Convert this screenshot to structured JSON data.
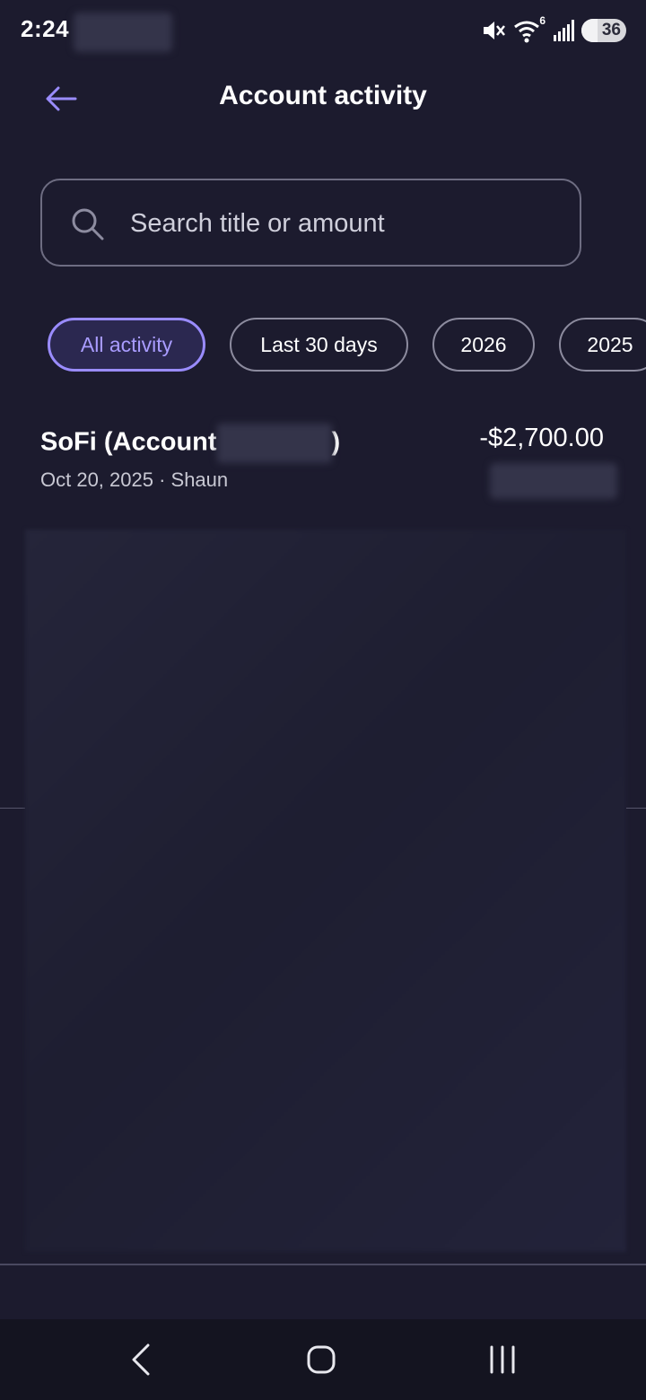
{
  "status_bar": {
    "time": "2:24",
    "battery": "36",
    "wifi_badge": "6",
    "icons": [
      "mute-icon",
      "wifi-icon",
      "signal-icon",
      "battery-icon"
    ]
  },
  "header": {
    "title": "Account activity",
    "back_icon": "back-arrow-icon"
  },
  "search": {
    "placeholder": "Search title or amount",
    "value": ""
  },
  "filters": [
    {
      "label": "All activity",
      "selected": true
    },
    {
      "label": "Last 30 days",
      "selected": false
    },
    {
      "label": "2026",
      "selected": false
    },
    {
      "label": "2025",
      "selected": false
    }
  ],
  "transactions": [
    {
      "title": "SoFi (Account",
      "title_suffix": ")",
      "amount": "-$2,700.00",
      "subtitle": "Oct 20, 2025 · Shaun"
    }
  ],
  "nav": {
    "back": "nav-back-icon",
    "home": "nav-home-icon",
    "recents": "nav-recents-icon"
  },
  "colors": {
    "background": "#1c1b2e",
    "accent": "#9a8cff",
    "nav_background": "#141420"
  }
}
